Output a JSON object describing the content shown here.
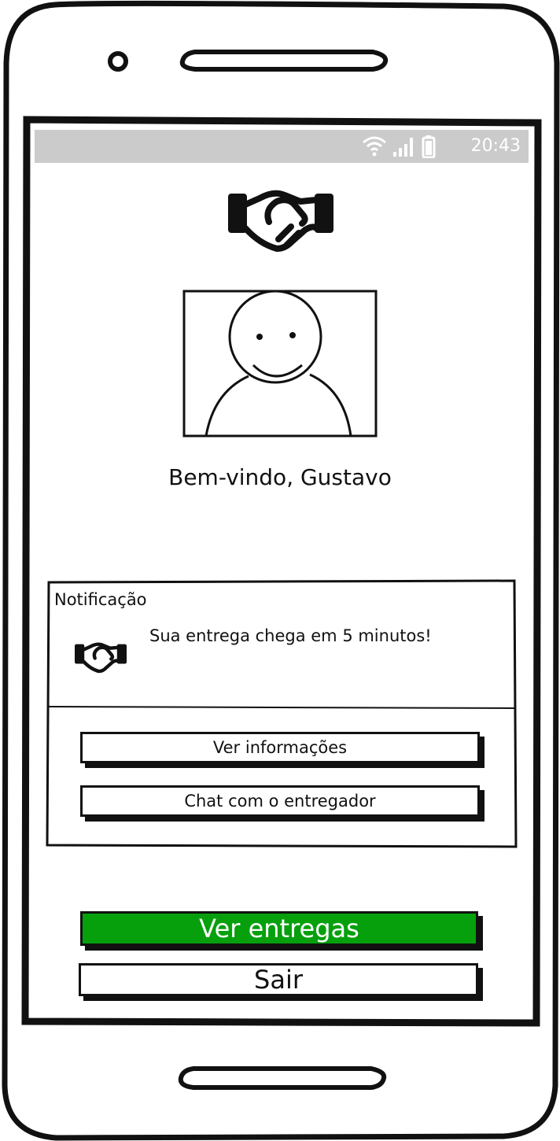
{
  "status_bar": {
    "time": "20:43",
    "icons": [
      "wifi-icon",
      "signal-icon",
      "battery-icon"
    ],
    "background": "#cbcbcb"
  },
  "logo": {
    "icon": "handshake-icon"
  },
  "profile": {
    "avatar": "avatar-placeholder"
  },
  "welcome_text": "Bem-vindo, Gustavo",
  "notification": {
    "title": "Notificação",
    "icon": "handshake-icon",
    "message": "Sua entrega chega em 5 minutos!",
    "buttons": {
      "info_label": "Ver informações",
      "chat_label": "Chat com o entregador"
    }
  },
  "actions": {
    "deliveries_label": "Ver entregas",
    "logout_label": "Sair"
  },
  "colors": {
    "accent_green": "#07a00d"
  }
}
